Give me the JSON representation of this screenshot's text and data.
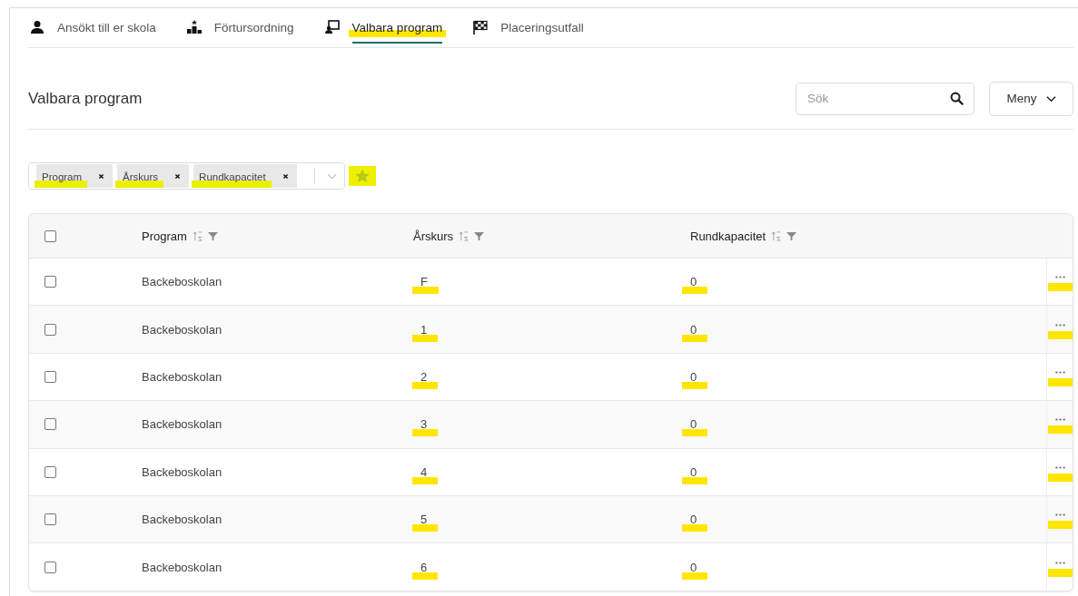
{
  "tabs": [
    {
      "label": "Ansökt till er skola",
      "selected": false,
      "highlighted": false
    },
    {
      "label": "Förtursordning",
      "selected": false,
      "highlighted": false
    },
    {
      "label": "Valbara program",
      "selected": true,
      "highlighted": true
    },
    {
      "label": "Placeringsutfall",
      "selected": false,
      "highlighted": false
    }
  ],
  "page_title": "Valbara program",
  "search": {
    "placeholder": "Sök"
  },
  "menu_button": "Meny",
  "filter": {
    "chips": [
      {
        "label": "Program",
        "highlighted": true
      },
      {
        "label": "Årskurs",
        "highlighted": true
      },
      {
        "label": "Rundkapacitet",
        "highlighted": true
      }
    ],
    "star_highlighted": true
  },
  "table": {
    "all_checked": false,
    "columns": [
      "Program",
      "Årskurs",
      "Rundkapacitet"
    ],
    "rows": [
      {
        "program": "Backeboskolan",
        "arskurs": "F",
        "kapacitet": "0",
        "checked": false,
        "highlighted": true
      },
      {
        "program": "Backeboskolan",
        "arskurs": "1",
        "kapacitet": "0",
        "checked": false,
        "highlighted": true
      },
      {
        "program": "Backeboskolan",
        "arskurs": "2",
        "kapacitet": "0",
        "checked": false,
        "highlighted": true
      },
      {
        "program": "Backeboskolan",
        "arskurs": "3",
        "kapacitet": "0",
        "checked": false,
        "highlighted": true
      },
      {
        "program": "Backeboskolan",
        "arskurs": "4",
        "kapacitet": "0",
        "checked": false,
        "highlighted": true
      },
      {
        "program": "Backeboskolan",
        "arskurs": "5",
        "kapacitet": "0",
        "checked": false,
        "highlighted": true
      },
      {
        "program": "Backeboskolan",
        "arskurs": "6",
        "kapacitet": "0",
        "checked": false,
        "highlighted": true
      }
    ]
  }
}
